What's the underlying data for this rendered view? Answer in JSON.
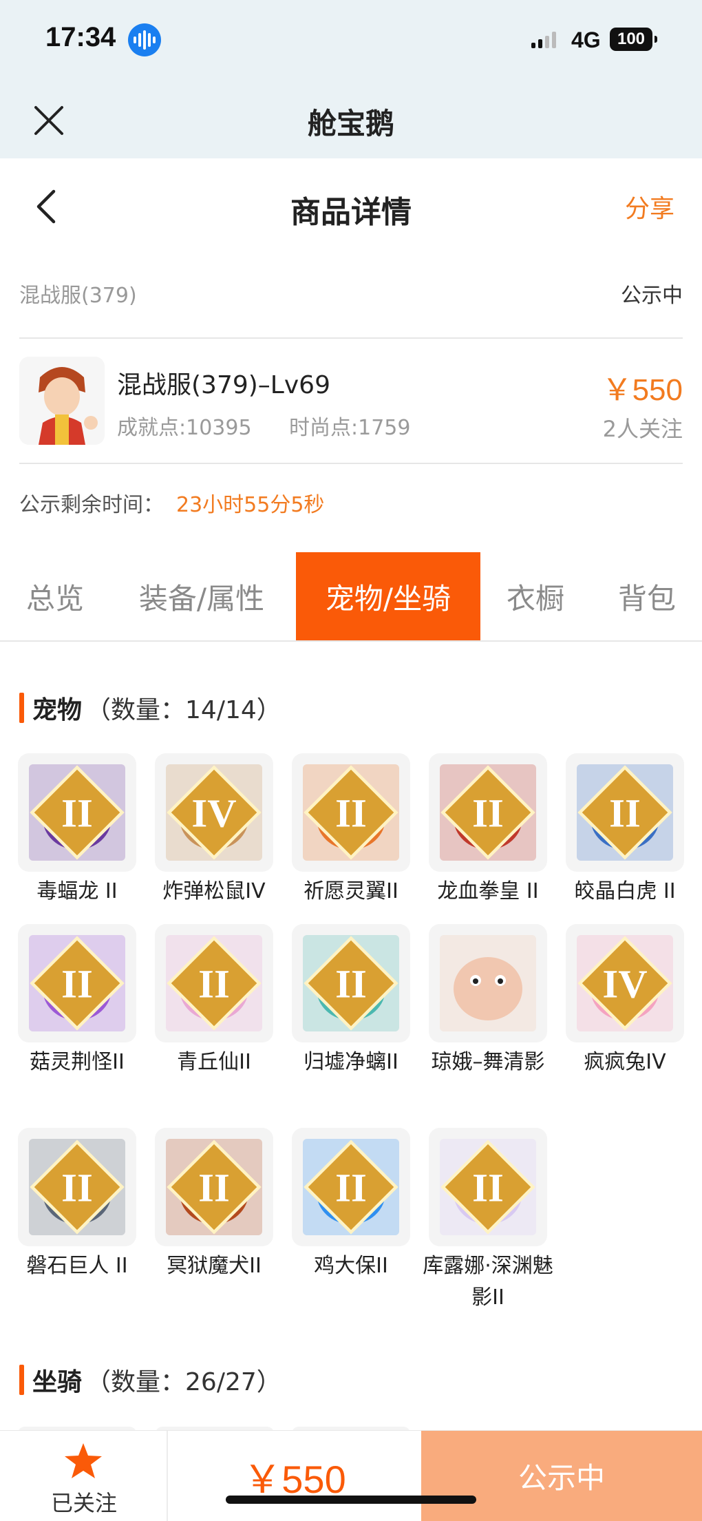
{
  "status_bar": {
    "time": "17:34",
    "network": "4G",
    "battery": "100"
  },
  "app_bar": {
    "title": "舱宝鹅",
    "close_icon": "close-icon"
  },
  "header": {
    "title": "商品详情",
    "share_label": "分享",
    "back_icon": "chevron-left-icon"
  },
  "listing": {
    "server": "混战服(379)",
    "status": "公示中",
    "character_name": "混战服(379)–Lv69",
    "achievement": "成就点:10395",
    "fashion": "时尚点:1759",
    "price": "￥550",
    "followers": "2人关注",
    "timer_label": "公示剩余时间：",
    "timer_value": "23小时55分5秒"
  },
  "tabs": [
    {
      "label": "总览",
      "active": false
    },
    {
      "label": "装备/属性",
      "active": false
    },
    {
      "label": "宠物/坐骑",
      "active": true
    },
    {
      "label": "衣橱",
      "active": false
    },
    {
      "label": "背包",
      "active": false
    }
  ],
  "pets_section": {
    "title": "宠物",
    "count": "（数量：14/14）"
  },
  "pets": [
    {
      "name": "毒蝠龙 II",
      "badge": "II",
      "color": "#6a3aa0"
    },
    {
      "name": "炸弹松鼠IV",
      "badge": "IV",
      "color": "#c9935a"
    },
    {
      "name": "祈愿灵翼II",
      "badge": "II",
      "color": "#e8762a"
    },
    {
      "name": "龙血拳皇 II",
      "badge": "II",
      "color": "#c0392b"
    },
    {
      "name": "皎晶白虎 II",
      "badge": "II",
      "color": "#3a6fc4"
    },
    {
      "name": "菇灵荆怪II",
      "badge": "II",
      "color": "#9b59d6"
    },
    {
      "name": "青丘仙II",
      "badge": "II",
      "color": "#e9a8d4"
    },
    {
      "name": "归墟净螭II",
      "badge": "II",
      "color": "#4bb8b0"
    },
    {
      "name": "琼娥–舞清影",
      "badge": "",
      "color": "#f1c7b0"
    },
    {
      "name": "疯疯兔IV",
      "badge": "IV",
      "color": "#f4a3c0"
    },
    {
      "name": "磐石巨人 II",
      "badge": "II",
      "color": "#5a6678"
    },
    {
      "name": "冥狱魔犬II",
      "badge": "II",
      "color": "#b34a1e"
    },
    {
      "name": "鸡大保II",
      "badge": "II",
      "color": "#2f8ff0"
    },
    {
      "name": "库露娜·深渊魅影II",
      "badge": "II",
      "color": "#d8c9f2"
    }
  ],
  "mounts_section": {
    "title": "坐骑",
    "count": "（数量：26/27）"
  },
  "bottom_bar": {
    "follow_label": "已关注",
    "price": "￥550",
    "status_button": "公示中"
  },
  "colors": {
    "accent": "#fa5a08",
    "price": "#f27b20",
    "button_disabled": "#f9ab7d"
  }
}
